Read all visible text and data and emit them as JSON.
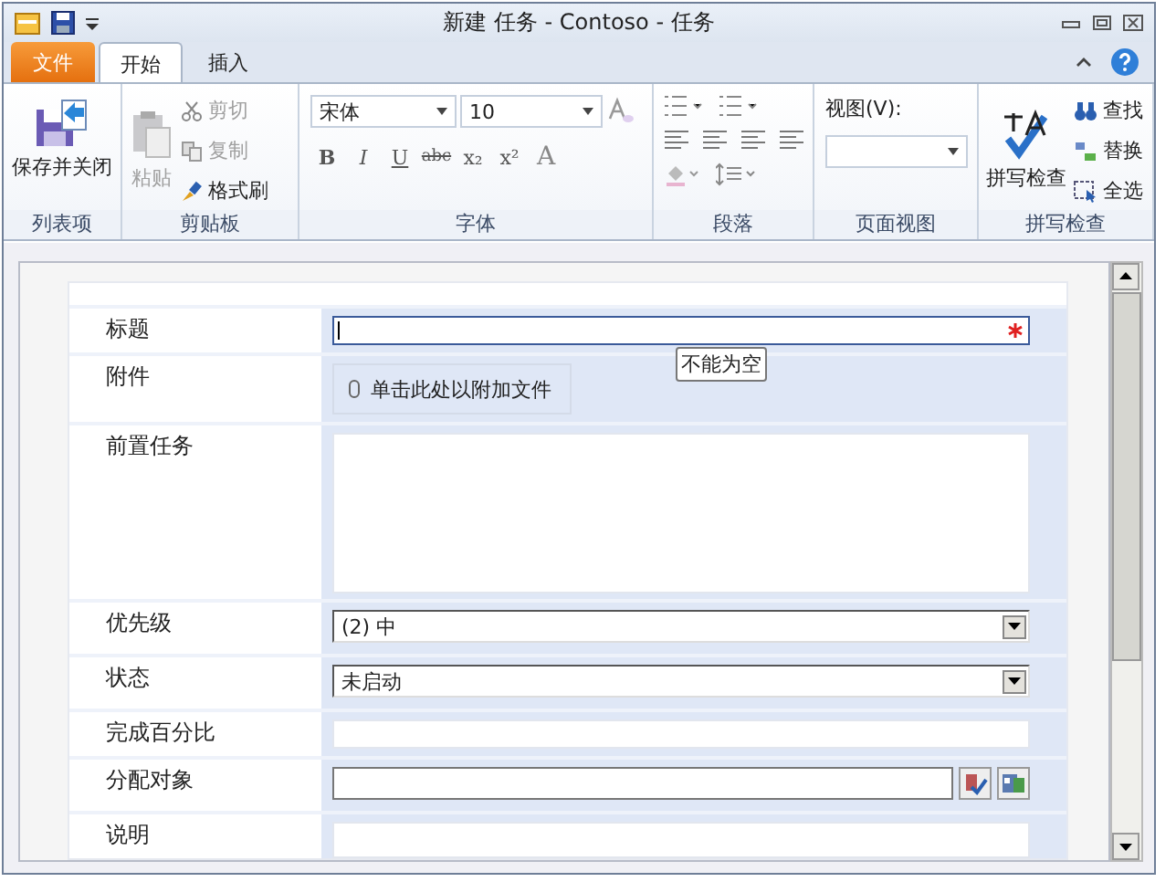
{
  "window": {
    "title": "新建 任务 - Contoso - 任务"
  },
  "ribbon": {
    "file_tab": "文件",
    "tabs": [
      {
        "label": "开始",
        "selected": true
      },
      {
        "label": "插入",
        "selected": false
      }
    ],
    "list_group": {
      "save_close": "保存并关闭",
      "label": "列表项"
    },
    "clipboard": {
      "paste": {
        "label": "粘贴",
        "disabled": true
      },
      "items": [
        {
          "kind": "cut",
          "label": "剪切",
          "disabled": true
        },
        {
          "kind": "copy",
          "label": "复制",
          "disabled": true
        },
        {
          "kind": "brush",
          "label": "格式刷",
          "disabled": false
        }
      ],
      "label": "剪贴板"
    },
    "font": {
      "family": "宋体",
      "size": "10",
      "formats": [
        {
          "kind": "bold",
          "text": "B"
        },
        {
          "kind": "italic",
          "text": "I"
        },
        {
          "kind": "underline",
          "text": "U"
        },
        {
          "kind": "strike",
          "text": "abc"
        },
        {
          "kind": "sub",
          "text": "x₂"
        },
        {
          "kind": "sup",
          "text": "x²"
        },
        {
          "kind": "color",
          "text": "A"
        }
      ],
      "label": "字体"
    },
    "paragraph": {
      "label": "段落"
    },
    "page_view": {
      "view_label": "视图(V):",
      "label": "页面视图"
    },
    "proofing": {
      "spell": "拼写检查",
      "items": [
        {
          "kind": "find",
          "label": "查找"
        },
        {
          "kind": "replace",
          "label": "替换"
        },
        {
          "kind": "select",
          "label": "全选"
        }
      ],
      "label": "拼写检查"
    }
  },
  "form": {
    "rows": [
      {
        "label": "标题",
        "kind": "text",
        "required": true,
        "focused": true,
        "tooltip": "不能为空"
      },
      {
        "label": "附件",
        "kind": "attachment",
        "link": "单击此处以附加文件"
      },
      {
        "label": "前置任务",
        "kind": "textarea"
      },
      {
        "label": "优先级",
        "kind": "dropdown",
        "value": "(2) 中"
      },
      {
        "label": "状态",
        "kind": "dropdown",
        "value": "未启动"
      },
      {
        "label": "完成百分比",
        "kind": "text",
        "required": false,
        "focused": false
      },
      {
        "label": "分配对象",
        "kind": "people"
      },
      {
        "label": "说明",
        "kind": "textarea_cut"
      }
    ]
  }
}
